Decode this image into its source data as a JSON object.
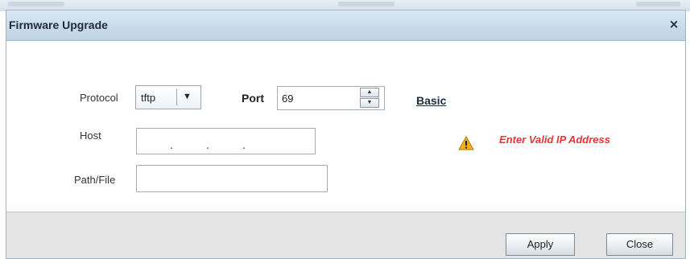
{
  "dialog": {
    "title": "Firmware Upgrade",
    "close_glyph": "×"
  },
  "form": {
    "protocol": {
      "label": "Protocol",
      "selected": "tftp",
      "dropdown_icon": "triangle-down-icon"
    },
    "port": {
      "label": "Port",
      "value": "69"
    },
    "basic_link": "Basic",
    "host": {
      "label": "Host",
      "value": "",
      "ip_separators": [
        ".",
        ".",
        "."
      ]
    },
    "path_file": {
      "label": "Path/File",
      "value": ""
    },
    "warning": {
      "icon": "warning-icon",
      "text": "Enter Valid IP Address",
      "color": "#e8333a"
    }
  },
  "footer": {
    "apply_label": "Apply",
    "close_label": "Close"
  }
}
